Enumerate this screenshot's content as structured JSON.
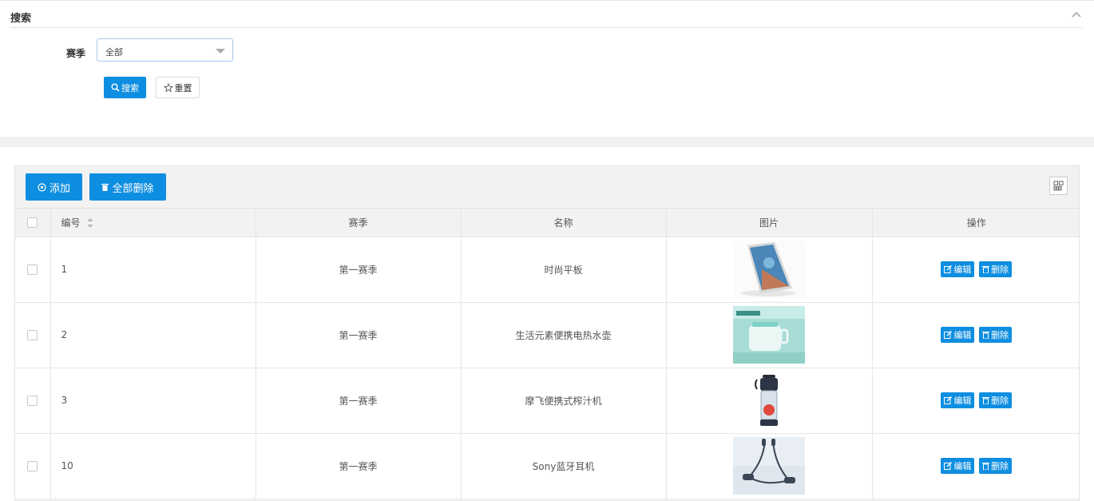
{
  "search": {
    "title": "搜索",
    "season_label": "赛季",
    "season_value": "全部",
    "search_button": "搜索",
    "reset_button": "重置"
  },
  "toolbar": {
    "add_label": "添加",
    "delete_all_label": "全部删除"
  },
  "table": {
    "headers": {
      "id": "编号",
      "season": "赛季",
      "name": "名称",
      "image": "图片",
      "ops": "操作"
    },
    "edit_label": "编辑",
    "delete_label": "删除",
    "rows": [
      {
        "id": "1",
        "season": "第一赛季",
        "name": "时尚平板"
      },
      {
        "id": "2",
        "season": "第一赛季",
        "name": "生活元素便携电热水壶"
      },
      {
        "id": "3",
        "season": "第一赛季",
        "name": "摩飞便携式榨汁机"
      },
      {
        "id": "10",
        "season": "第一赛季",
        "name": "Sony蓝牙耳机"
      }
    ]
  },
  "colors": {
    "primary": "#0e8ee0"
  }
}
